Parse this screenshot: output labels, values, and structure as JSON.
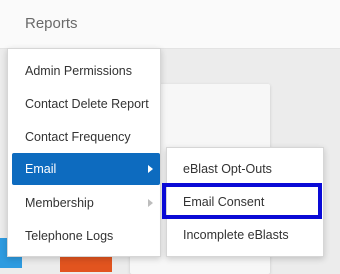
{
  "header": {
    "title": "Reports"
  },
  "menu": {
    "items": [
      {
        "label": "Admin Permissions"
      },
      {
        "label": "Contact Delete Report"
      },
      {
        "label": "Contact Frequency"
      },
      {
        "label": "Email"
      },
      {
        "label": "Membership"
      },
      {
        "label": "Telephone Logs"
      }
    ]
  },
  "submenu": {
    "items": [
      {
        "label": "eBlast Opt-Outs"
      },
      {
        "label": "Email Consent"
      },
      {
        "label": "Incomplete eBlasts"
      }
    ]
  },
  "colors": {
    "active_item": "#0d6bbf",
    "highlight_box": "#0a0ad6"
  }
}
